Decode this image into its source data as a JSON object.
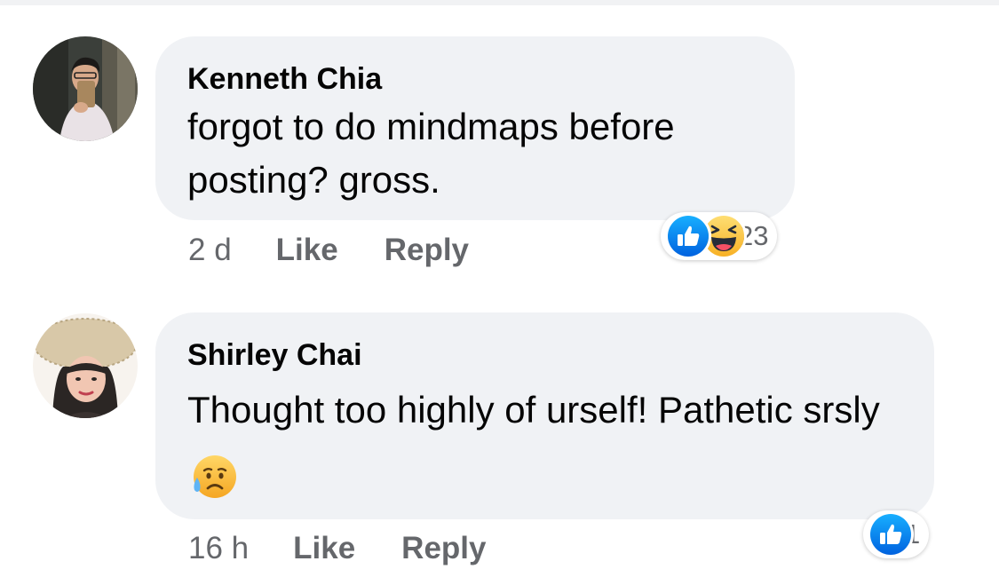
{
  "comments": [
    {
      "author": "Kenneth Chia",
      "text": "forgot to do mindmaps before posting? gross.",
      "time": "2 d",
      "like_label": "Like",
      "reply_label": "Reply",
      "reaction_icons": [
        "like-icon",
        "haha-icon"
      ],
      "reaction_count": "23"
    },
    {
      "author": "Shirley Chai",
      "text": "Thought too highly of urself! Pathetic srsly",
      "inline_emoji": "sad-but-relieved-face-icon",
      "time": "16 h",
      "like_label": "Like",
      "reply_label": "Reply",
      "reaction_icons": [
        "like-icon"
      ],
      "reaction_count": "1"
    }
  ],
  "colors": {
    "bubble": "#f0f2f5",
    "secondary_text": "#65676b",
    "like_blue": "#1877f2",
    "haha_yellow": "#f7b125"
  }
}
